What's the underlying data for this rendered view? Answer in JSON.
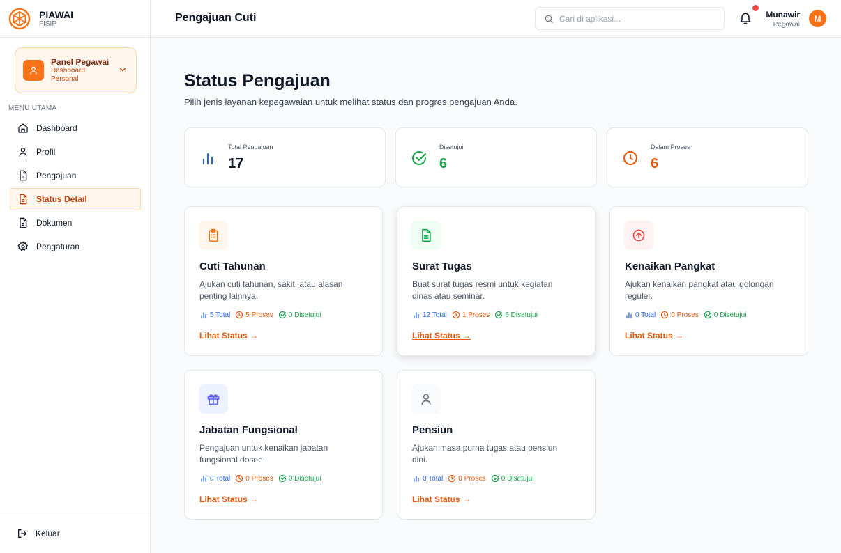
{
  "brand": {
    "name": "PIAWAI",
    "subtitle": "FISIP"
  },
  "panel": {
    "title": "Panel Pegawai",
    "subtitle": "Dashboard Personal"
  },
  "sidebar": {
    "heading": "MENU UTAMA",
    "items": [
      {
        "label": "Dashboard",
        "icon": "home-icon"
      },
      {
        "label": "Profil",
        "icon": "user-icon"
      },
      {
        "label": "Pengajuan",
        "icon": "document-icon"
      },
      {
        "label": "Status Detail",
        "icon": "document-icon",
        "active": true
      },
      {
        "label": "Dokumen",
        "icon": "document-icon"
      },
      {
        "label": "Pengaturan",
        "icon": "gear-icon"
      }
    ],
    "logout_label": "Keluar"
  },
  "header": {
    "title": "Pengajuan Cuti",
    "search_placeholder": "Cari di aplikasi...",
    "user_name": "Munawir",
    "user_role": "Pegawai",
    "avatar_initial": "M"
  },
  "main": {
    "heading": "Status Pengajuan",
    "subheading": "Pilih jenis layanan kepegawaian untuk melihat status dan progres pengajuan Anda."
  },
  "stats": [
    {
      "label": "Total Pengajuan",
      "value": "17",
      "color": "#111827",
      "icon": "bar-chart-icon"
    },
    {
      "label": "Disetujui",
      "value": "6",
      "color": "#16a34a",
      "icon": "check-circle-icon"
    },
    {
      "label": "Dalam Proses",
      "value": "6",
      "color": "#ea580c",
      "icon": "clock-icon"
    }
  ],
  "cards": [
    {
      "title": "Cuti Tahunan",
      "desc": "Ajukan cuti tahunan, sakit, atau alasan penting lainnya.",
      "total": "5 Total",
      "proses": "5 Proses",
      "disetujui": "0 Disetujui",
      "link": "Lihat Status →",
      "icon": "clipboard-icon"
    },
    {
      "title": "Surat Tugas",
      "desc": "Buat surat tugas resmi untuk kegiatan dinas atau seminar.",
      "total": "12 Total",
      "proses": "1 Proses",
      "disetujui": "6 Disetujui",
      "link": "Lihat Status →",
      "icon": "file-text-icon"
    },
    {
      "title": "Kenaikan Pangkat",
      "desc": "Ajukan kenaikan pangkat atau golongan reguler.",
      "total": "0 Total",
      "proses": "0 Proses",
      "disetujui": "0 Disetujui",
      "link": "Lihat Status →",
      "icon": "arrow-up-circle-icon"
    },
    {
      "title": "Jabatan Fungsional",
      "desc": "Pengajuan untuk kenaikan jabatan fungsional dosen.",
      "total": "0 Total",
      "proses": "0 Proses",
      "disetujui": "0 Disetujui",
      "link": "Lihat Status →",
      "icon": "gift-icon"
    },
    {
      "title": "Pensiun",
      "desc": "Ajukan masa purna tugas atau pensiun dini.",
      "total": "0 Total",
      "proses": "0 Proses",
      "disetujui": "0 Disetujui",
      "link": "Lihat Status →",
      "icon": "user-icon"
    }
  ],
  "colors": {
    "accent": "#f97316",
    "success": "#16a34a",
    "info": "#2563eb",
    "danger": "#ef4444"
  }
}
